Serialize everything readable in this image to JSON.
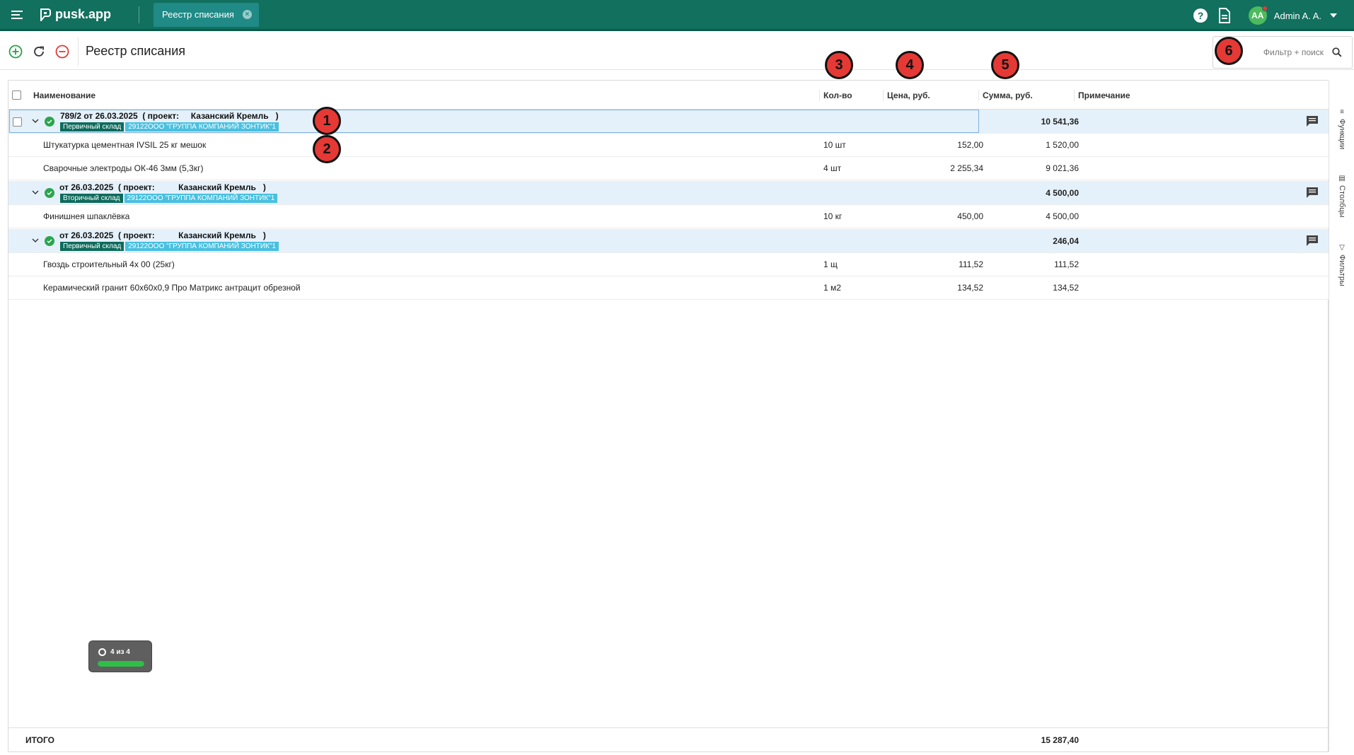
{
  "app": {
    "logo_text": "pusk.app",
    "active_tab": "Реестр списания",
    "user_initials": "AA",
    "user_name": "Admin A. A."
  },
  "toolbar": {
    "title": "Реестр списания",
    "search_placeholder": "Фильтр + поиск"
  },
  "columns": {
    "name": "Наименование",
    "qty": "Кол-во",
    "price": "Цена, руб.",
    "sum": "Сумма, руб.",
    "note": "Примечание"
  },
  "groups": [
    {
      "title": "789/2 от 26.03.2025  ( проект:     Казанский Кремль   )",
      "warehouse": "Первичный склад",
      "company": "29122ООО \"ГРУППА КОМПАНИЙ ЗОНТИК\"1",
      "total": "10 541,36",
      "items": [
        {
          "name": "Штукатурка цементная IVSIL 25 кг мешок",
          "qty": "10 шт",
          "price": "152,00",
          "sum": "1 520,00"
        },
        {
          "name": "Сварочные электроды ОК-46 3мм (5,3кг)",
          "qty": "4 шт",
          "price": "2 255,34",
          "sum": "9 021,36"
        }
      ]
    },
    {
      "title": "от 26.03.2025  ( проект:          Казанский Кремль   )",
      "warehouse": "Вторичный склад",
      "company": "29122ООО \"ГРУППА КОМПАНИЙ ЗОНТИК\"1",
      "total": "4 500,00",
      "items": [
        {
          "name": "Финишнея шпаклёвка",
          "qty": "10 кг",
          "price": "450,00",
          "sum": "4 500,00"
        }
      ]
    },
    {
      "title": "от 26.03.2025  ( проект:          Казанский Кремль   )",
      "warehouse": "Первичный склад",
      "company": "29122ООО \"ГРУППА КОМПАНИЙ ЗОНТИК\"1",
      "total": "246,04",
      "items": [
        {
          "name": "Гвоздь строительный 4х 00 (25кг)",
          "qty": "1 щ",
          "price": "111,52",
          "sum": "111,52"
        },
        {
          "name": "Керамический гранит 60х60х0,9 Про Матрикс антрацит обрезной",
          "qty": "1 м2",
          "price": "134,52",
          "sum": "134,52"
        }
      ]
    }
  ],
  "footer": {
    "label": "ИТОГО",
    "total": "15 287,40"
  },
  "side_panel": [
    "Функции",
    "Столбцы",
    "Фильтры"
  ],
  "progress": {
    "text": "4 из 4",
    "fraction": 1.0
  },
  "callouts": [
    "1",
    "2",
    "3",
    "4",
    "5",
    "6"
  ],
  "colors": {
    "topbar": "#12705e",
    "tab": "#1f8a86",
    "group_row": "#e5f1fa",
    "tag_dark": "#0d6b5c",
    "tag_light": "#49c0e0",
    "callout": "#e53935"
  }
}
